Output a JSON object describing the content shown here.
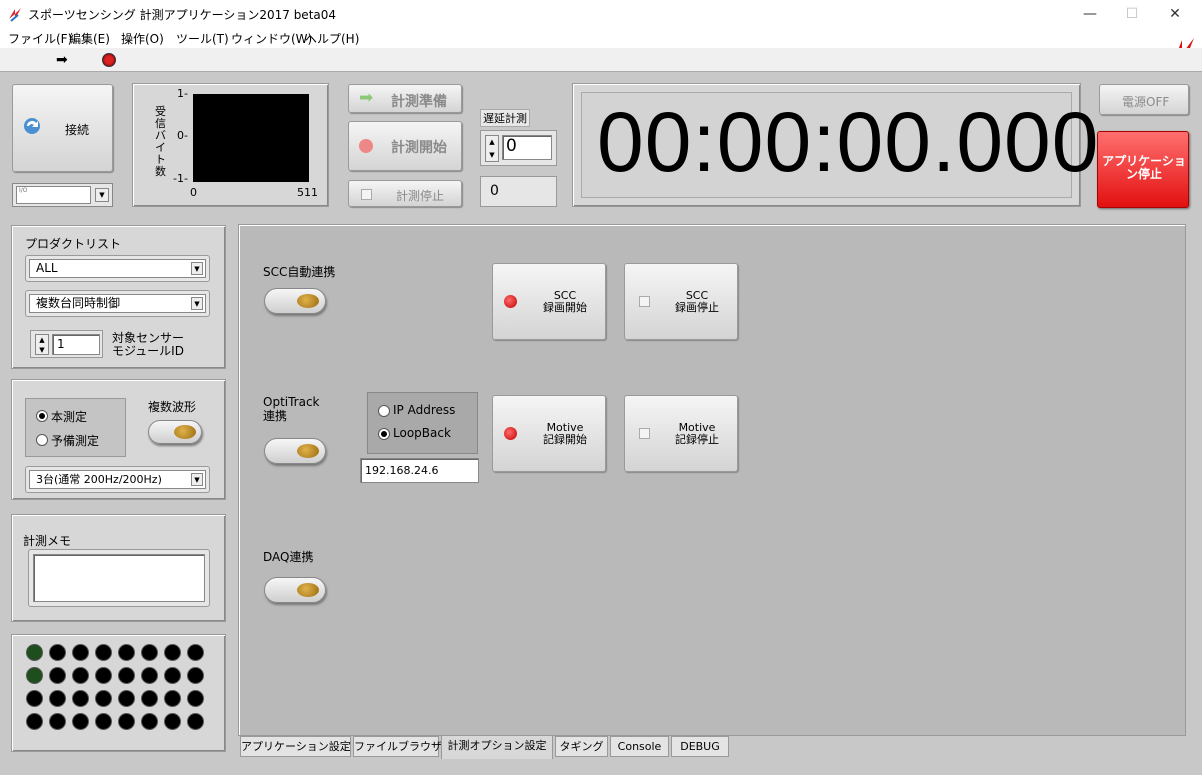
{
  "window": {
    "title": "スポーツセンシング 計測アプリケーション2017 beta04",
    "minimize": "—",
    "maximize": "☐",
    "close": "✕"
  },
  "menu": [
    "ファイル(F)",
    "編集(E)",
    "操作(O)",
    "ツール(T)",
    "ウィンドウ(W)",
    "ヘルプ(H)"
  ],
  "connect": {
    "label": "接続",
    "combo_prefix": "I/O"
  },
  "graph": {
    "ylabel": "受信バイト数",
    "yticks": [
      "1-",
      "0-",
      "-1-"
    ],
    "xticks": [
      "0",
      "511"
    ]
  },
  "controls": {
    "prepare": "計測準備",
    "start": "計測開始",
    "stop": "計測停止",
    "delay_label": "遅延計測",
    "delay_value": "0",
    "delay_readout": "0"
  },
  "timer": "00:00:00.000",
  "power_off": "電源OFF",
  "app_stop": "アプリケーション停止",
  "product": {
    "title": "プロダクトリスト",
    "list_value": "ALL",
    "mode_value": "複数台同時制御",
    "sensor_id_value": "1",
    "sensor_id_label_1": "対象センサー",
    "sensor_id_label_2": "モジュールID"
  },
  "measure": {
    "radio_main": "本測定",
    "radio_pre": "予備測定",
    "multi_wave": "複数波形",
    "rate_value": "3台(通常 200Hz/200Hz)"
  },
  "memo": {
    "title": "計測メモ",
    "value": ""
  },
  "leds": {
    "rows": 4,
    "cols": 8,
    "on": [
      0,
      8
    ]
  },
  "options": {
    "scc_label": "SCC自動連携",
    "scc_rec_start_1": "SCC",
    "scc_rec_start_2": "録画開始",
    "scc_rec_stop_1": "SCC",
    "scc_rec_stop_2": "録画停止",
    "optitrack_label_1": "OptiTrack",
    "optitrack_label_2": "連携",
    "ip_address": "IP Address",
    "loopback": "LoopBack",
    "ip_value": "192.168.24.6",
    "motive_start_1": "Motive",
    "motive_start_2": "記録開始",
    "motive_stop_1": "Motive",
    "motive_stop_2": "記録停止",
    "daq_label": "DAQ連携"
  },
  "tabs": [
    "アプリケーション設定",
    "ファイルブラウザ",
    "計測オプション設定",
    "タギング",
    "Console",
    "DEBUG"
  ],
  "active_tab": 2
}
